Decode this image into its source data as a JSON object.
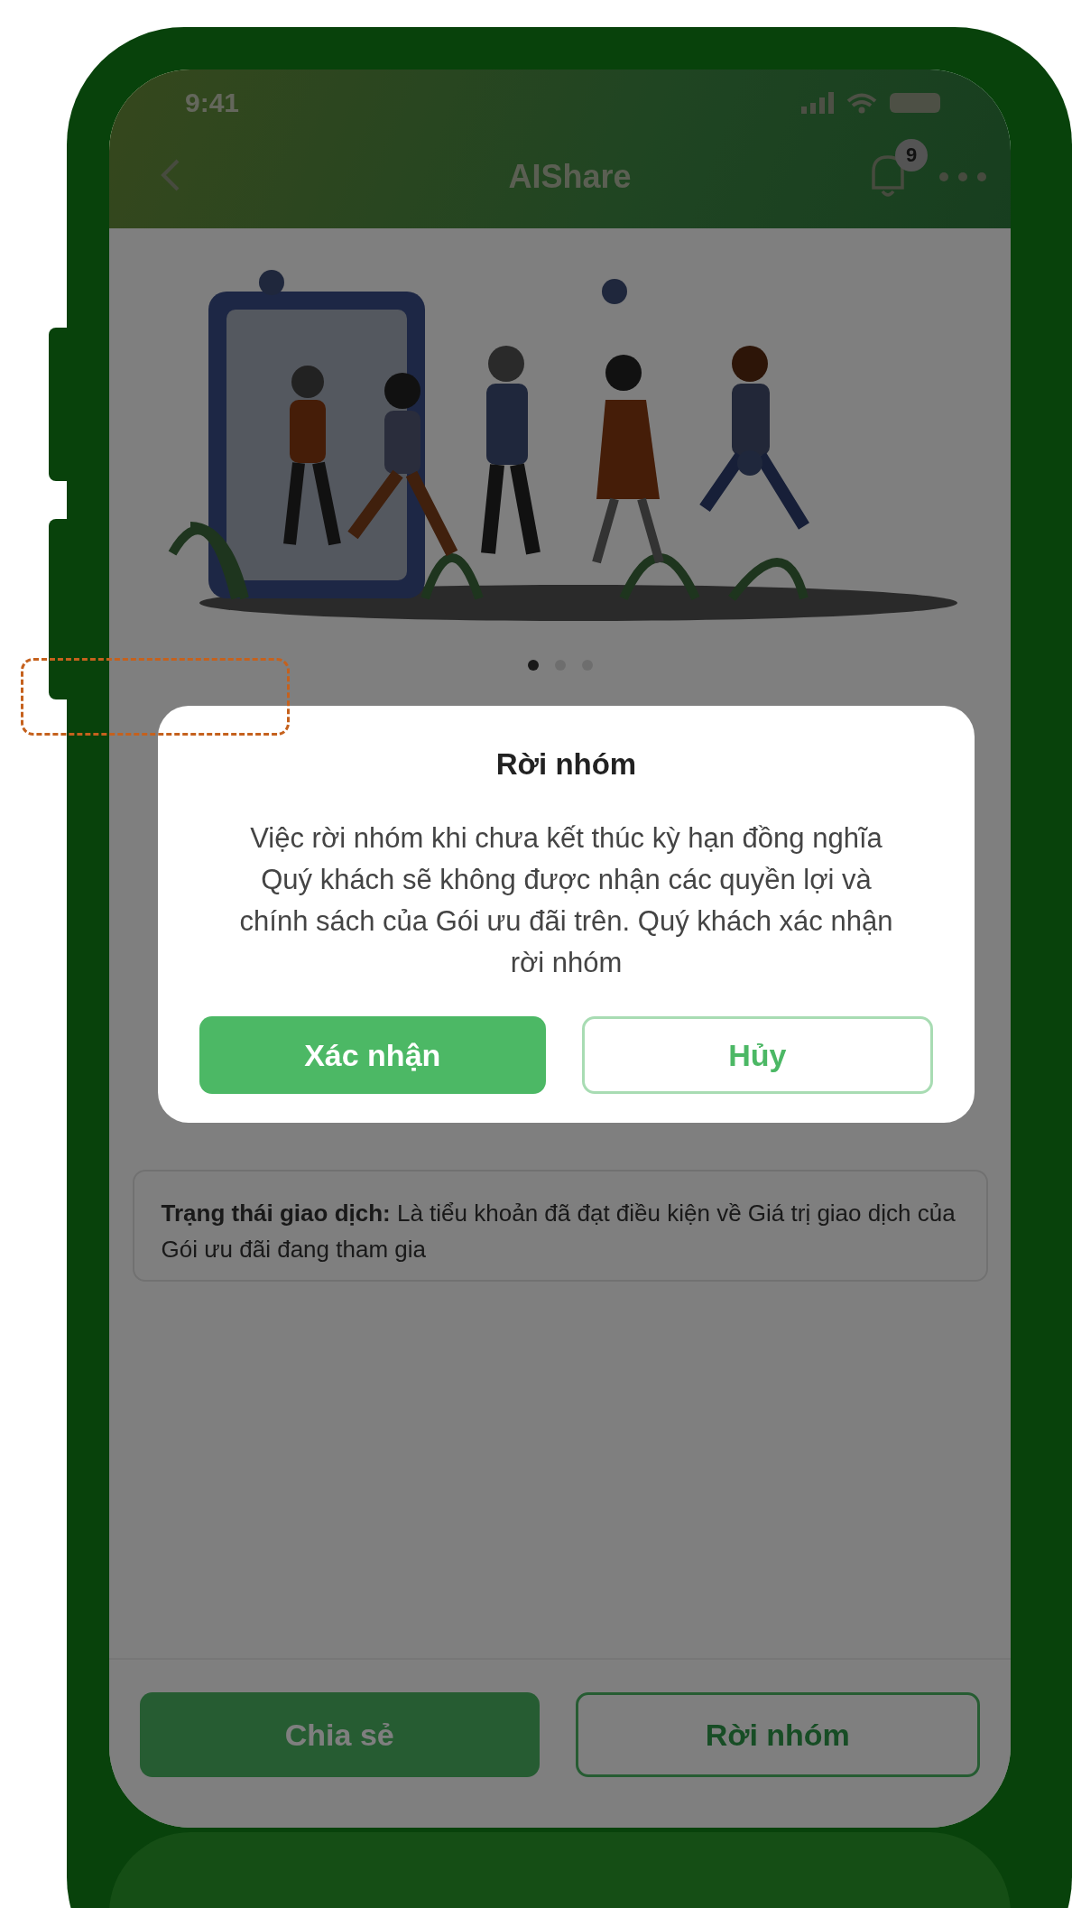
{
  "status_bar": {
    "time": "9:41"
  },
  "header": {
    "title": "AIShare",
    "notification_count": "9"
  },
  "carousel": {
    "dots": [
      {
        "selected": true
      },
      {
        "selected": false
      },
      {
        "selected": false
      }
    ]
  },
  "info_card": {
    "text": "**Trạng thái giao dịch:** Là tiểu khoản đã đạt điều kiện về Giá trị giao dịch của Gói ưu đãi đang tham gia"
  },
  "footer_buttons": [
    {
      "label": "Chia sẻ",
      "kind": "primary"
    },
    {
      "label": "Rời nhóm",
      "kind": "outline"
    }
  ],
  "dialog": {
    "title": "Rời nhóm",
    "message": "Việc rời nhóm khi chưa kết thúc kỳ hạn đồng nghĩa Quý khách sẽ không được nhận các quyền lợi và chính sách của Gói ưu đãi trên. Quý khách xác nhận rời nhóm",
    "buttons": [
      {
        "label": "Xác nhận",
        "kind": "primary"
      },
      {
        "label": "Hủy",
        "kind": "outline"
      }
    ]
  }
}
